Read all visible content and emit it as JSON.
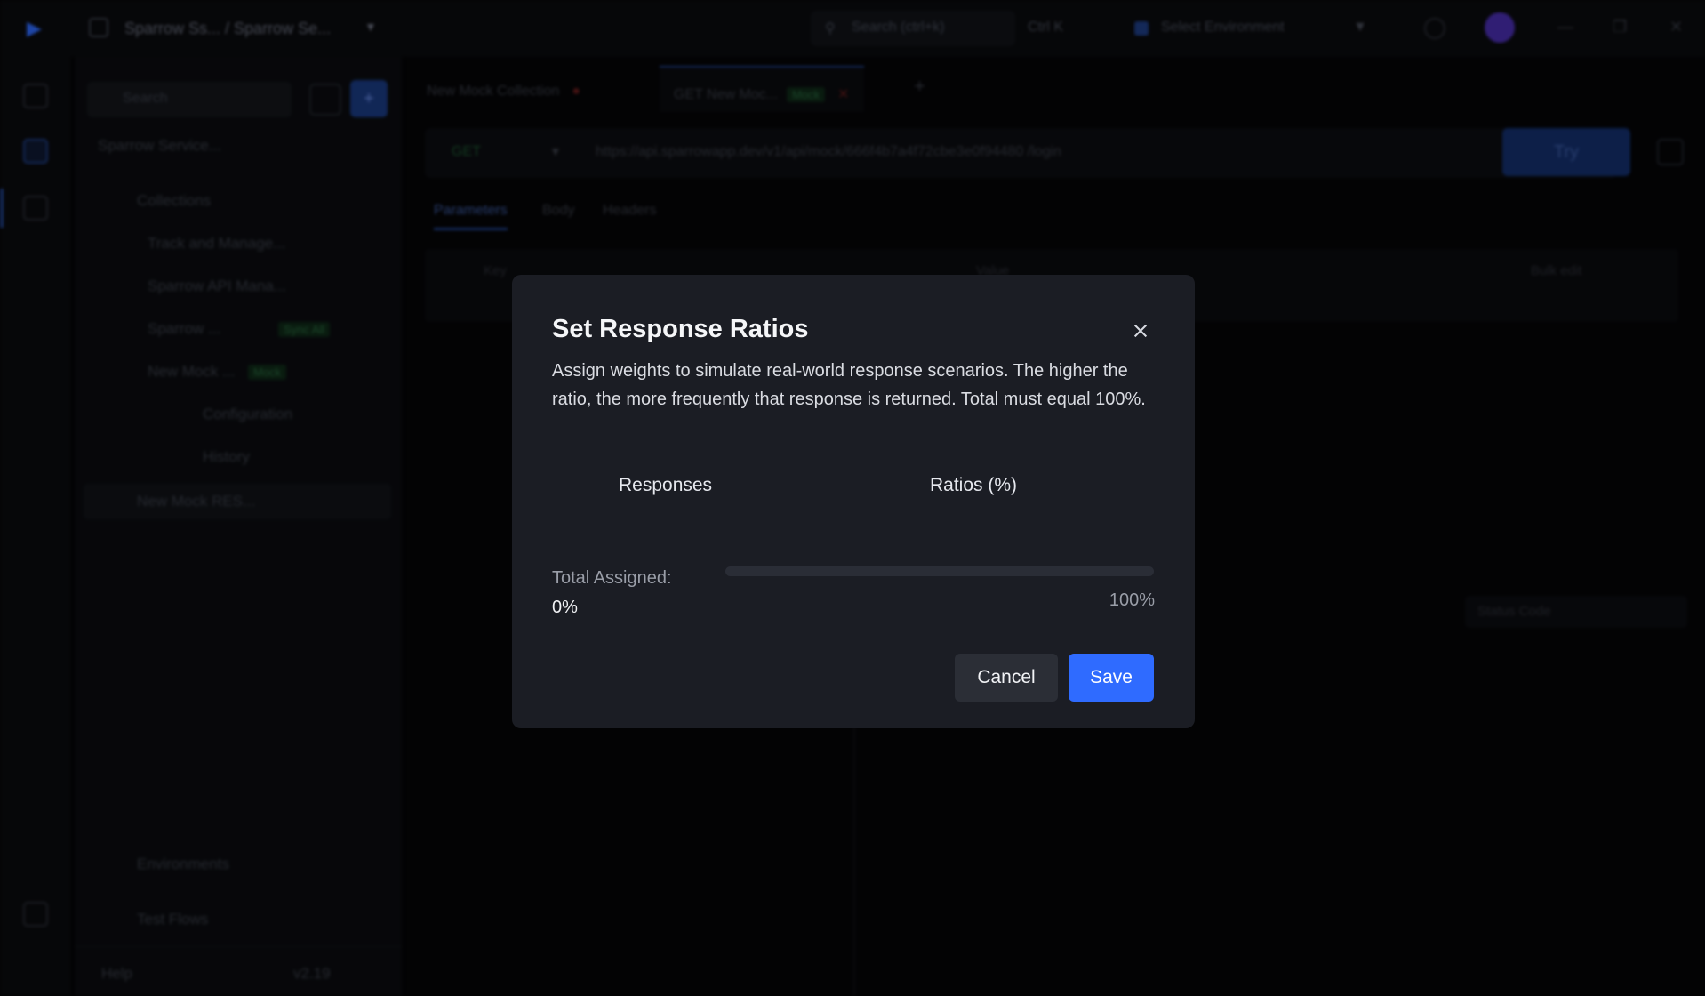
{
  "topbar": {
    "workspace": "Sparrow Ss... / Sparrow Se...",
    "search_placeholder": "Search (ctrl+k)",
    "shortcut": "Ctrl K",
    "environment": "Select Environment"
  },
  "sidebar": {
    "search_placeholder": "Search",
    "workspace_label": "Sparrow Service...",
    "items": [
      {
        "label": "Collections"
      },
      {
        "label": "Track and Manage..."
      },
      {
        "label": "Sparrow API Mana..."
      },
      {
        "label": "Sparrow ..."
      },
      {
        "label": "New Mock ..."
      },
      {
        "label": "Configuration"
      },
      {
        "label": "History"
      },
      {
        "label": "New Mock RES..."
      },
      {
        "label": "Environments"
      },
      {
        "label": "Test Flows"
      }
    ],
    "mock_tag": "Mock",
    "sync_tag": "Sync All",
    "footer_left": "Help",
    "footer_right": "v2.19"
  },
  "main": {
    "tabs": [
      {
        "label": "New Mock Collection"
      },
      {
        "label": "GET  New Moc..."
      }
    ],
    "mock_tag": "Mock",
    "method": "GET",
    "url": "https://api.sparrowapp.dev/v1/api/mock/666f4b7a4f72cbe3e0f94480  /login",
    "try_label": "Try",
    "subtabs": [
      "Parameters",
      "Body",
      "Headers"
    ],
    "param_headers": [
      "Key",
      "Value",
      "Bulk edit"
    ],
    "status_select": "Status Code"
  },
  "modal": {
    "title": "Set Response Ratios",
    "description": "Assign weights to simulate real-world response scenarios. The higher the ratio, the more frequently that response is returned. Total must equal 100%.",
    "columns": {
      "responses": "Responses",
      "ratios": "Ratios (%)"
    },
    "total_label": "Total Assigned:",
    "total_value": "0%",
    "total_fraction": 0,
    "max_label": "100%",
    "cancel_label": "Cancel",
    "save_label": "Save"
  },
  "colors": {
    "accent": "#2f6bff",
    "modal_bg": "#1b1d24",
    "background": "#050507"
  }
}
